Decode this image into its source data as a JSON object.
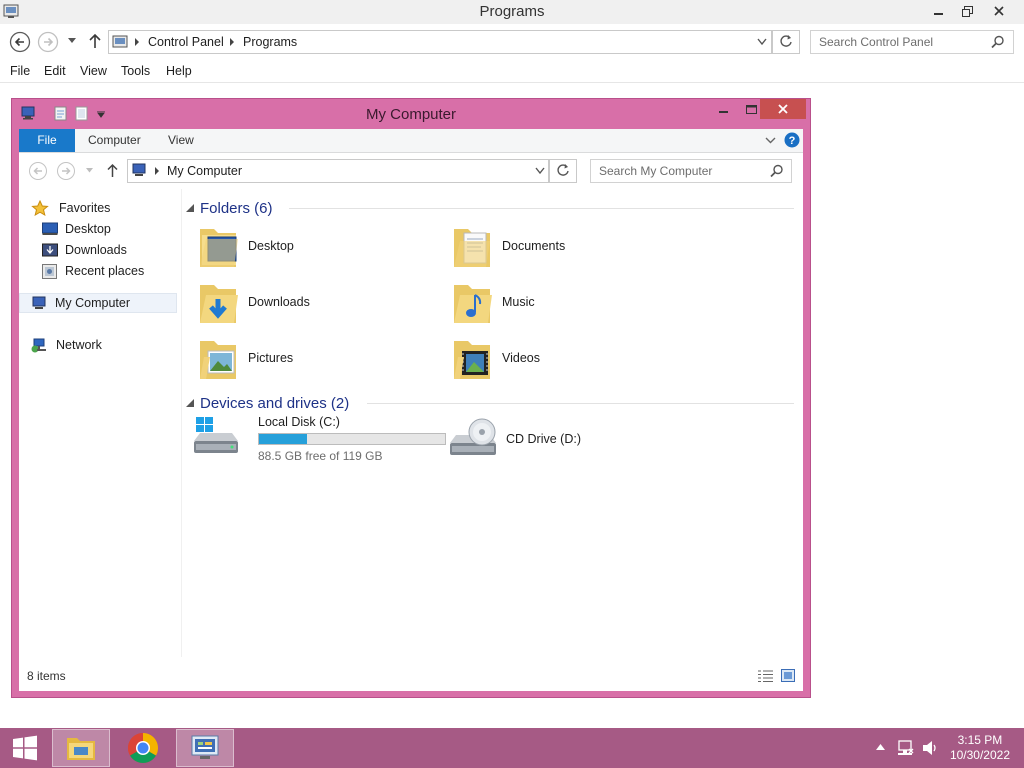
{
  "outer": {
    "title": "Programs",
    "breadcrumb": [
      "Control Panel",
      "Programs"
    ],
    "search_placeholder": "Search Control Panel",
    "menu": [
      "File",
      "Edit",
      "View",
      "Tools",
      "Help"
    ]
  },
  "explorer": {
    "title": "My Computer",
    "ribbon_tabs": [
      "File",
      "Computer",
      "View"
    ],
    "address": "My Computer",
    "search_placeholder": "Search My Computer",
    "nav": {
      "favorites": "Favorites",
      "desktop": "Desktop",
      "downloads": "Downloads",
      "recent": "Recent places",
      "my_computer": "My Computer",
      "network": "Network"
    },
    "folders_header": "Folders (6)",
    "folders": [
      {
        "name": "Desktop",
        "icon": "folder-desktop-icon"
      },
      {
        "name": "Documents",
        "icon": "folder-documents-icon"
      },
      {
        "name": "Downloads",
        "icon": "folder-downloads-icon"
      },
      {
        "name": "Music",
        "icon": "folder-music-icon"
      },
      {
        "name": "Pictures",
        "icon": "folder-pictures-icon"
      },
      {
        "name": "Videos",
        "icon": "folder-videos-icon"
      }
    ],
    "drives_header": "Devices and drives (2)",
    "drives": {
      "c": {
        "name": "Local Disk (C:)",
        "free_text": "88.5 GB free of 119 GB",
        "used_fraction": 0.256
      },
      "d": {
        "name": "CD Drive (D:)"
      }
    },
    "status_count": "8 items"
  },
  "taskbar": {
    "time": "3:15 PM",
    "date": "10/30/2022"
  },
  "colors": {
    "window_frame": "#d86fa8",
    "taskbar": "#a65a85",
    "accent_blue": "#1979ca",
    "group_header": "#1e3287",
    "close_button": "#c75050"
  }
}
